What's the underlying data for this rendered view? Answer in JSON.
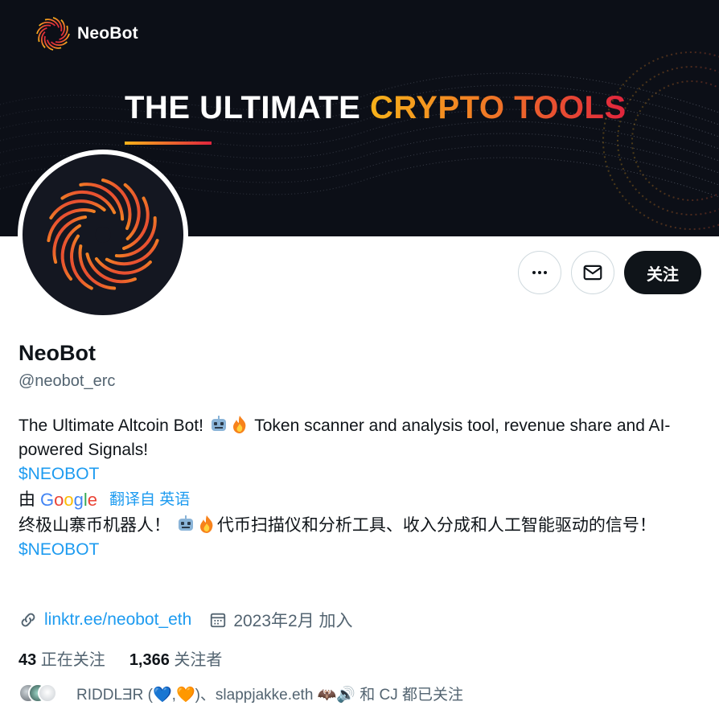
{
  "banner": {
    "brand_name": "NeoBot",
    "headline_main": "THE ULTIMATE ",
    "headline_accent": "CRYPTO TOOLS"
  },
  "actions": {
    "more_icon": "more-horizontal-icon",
    "message_icon": "envelope-icon",
    "follow_label": "关注"
  },
  "profile": {
    "name": "NeoBot",
    "handle": "@neobot_erc",
    "bio_part1": "The Ultimate Altcoin Bot! ",
    "bio_part2": " Token scanner and analysis tool, revenue share and AI-powered Signals!",
    "cashtag": "$NEOBOT",
    "translated_by": "由",
    "google": "Google",
    "translate_label": "翻译自 英语",
    "translated_part1": "终极山寨币机器人！ ",
    "translated_part2": "代币扫描仪和分析工具、收入分成和人工智能驱动的信号！",
    "translated_cashtag": "$NEOBOT"
  },
  "meta": {
    "link_icon": "link-icon",
    "link_text": "linktr.ee/neobot_eth",
    "calendar_icon": "calendar-icon",
    "joined_text": "2023年2月 加入"
  },
  "stats": {
    "following_count": "43",
    "following_label": " 正在关注",
    "followers_count": "1,366",
    "followers_label": " 关注者"
  },
  "followed_by": {
    "text": "RIDDLƎR (💙,🧡)、slappjakke.eth 🦇🔊 和 CJ 都已关注"
  },
  "colors": {
    "banner_bg": "#0c0f17",
    "accent_blue": "#1d9bf0",
    "follow_button": "#0f1419",
    "gradient_start": "#f7b21a",
    "gradient_end": "#e0243d"
  }
}
